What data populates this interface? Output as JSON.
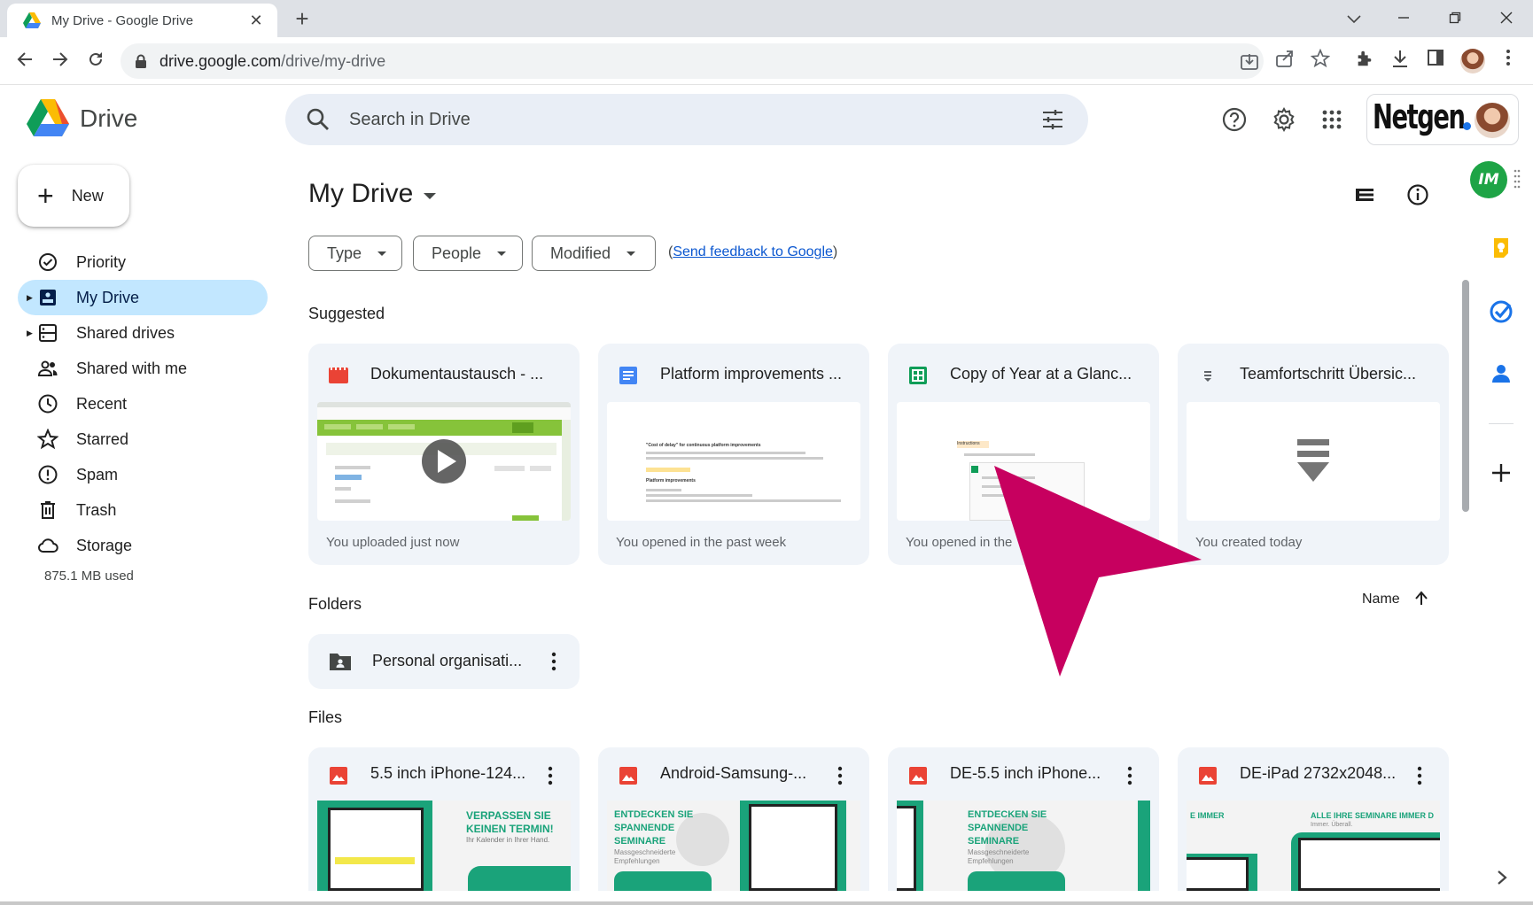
{
  "browser": {
    "tab_title": "My Drive - Google Drive",
    "url_host": "drive.google.com",
    "url_path": "/drive/my-drive"
  },
  "app": {
    "name": "Drive",
    "search_placeholder": "Search in Drive",
    "account_brand": "Netgen"
  },
  "sidebar": {
    "new_label": "New",
    "items": [
      {
        "label": "Priority",
        "icon": "priority-icon"
      },
      {
        "label": "My Drive",
        "icon": "my-drive-icon"
      },
      {
        "label": "Shared drives",
        "icon": "shared-drives-icon"
      },
      {
        "label": "Shared with me",
        "icon": "shared-with-me-icon"
      },
      {
        "label": "Recent",
        "icon": "clock-icon"
      },
      {
        "label": "Starred",
        "icon": "star-icon"
      },
      {
        "label": "Spam",
        "icon": "spam-icon"
      },
      {
        "label": "Trash",
        "icon": "trash-icon"
      },
      {
        "label": "Storage",
        "icon": "cloud-icon"
      }
    ],
    "storage_used": "875.1 MB used"
  },
  "main": {
    "title": "My Drive",
    "filters": {
      "type": "Type",
      "people": "People",
      "modified": "Modified",
      "feedback_prefix": "(",
      "feedback_link": "Send feedback to Google",
      "feedback_suffix": ")"
    },
    "suggested_label": "Suggested",
    "suggested": [
      {
        "name": "Dokumentaustausch - ...",
        "meta": "You uploaded just now",
        "icon": "video-file-icon"
      },
      {
        "name": "Platform improvements ...",
        "meta": "You opened in the past week",
        "icon": "google-docs-icon"
      },
      {
        "name": "Copy of Year at a Glanc...",
        "meta": "You opened in the",
        "icon": "google-sheets-icon"
      },
      {
        "name": "Teamfortschritt Übersic...",
        "meta": "You created today",
        "icon": "generic-file-icon"
      }
    ],
    "folders_label": "Folders",
    "sort_label": "Name",
    "folders": [
      {
        "name": "Personal organisati..."
      }
    ],
    "files_label": "Files",
    "files": [
      {
        "name": "5.5 inch iPhone-124..."
      },
      {
        "name": "Android-Samsung-..."
      },
      {
        "name": "DE-5.5 inch iPhone..."
      },
      {
        "name": "DE-iPad 2732x2048..."
      }
    ],
    "thumb_text": {
      "f1_a": "VERPASSEN SIE",
      "f1_b": "KEINEN TERMIN!",
      "f1_c": "Ihr Kalender in Ihrer Hand.",
      "f2_a": "ENTDECKEN SIE",
      "f2_b": "SPANNENDE",
      "f2_c": "SEMINARE",
      "f2_d": "Massgeschneiderte",
      "f2_e": "Empfehlungen",
      "f3_a": "ENTDECKEN SIE",
      "f3_b": "SPANNENDE",
      "f3_c": "SEMINARE",
      "f3_d": "Massgeschneiderte",
      "f3_e": "Empfehlungen",
      "f4_a": "E IMMER",
      "f4_b": "ALLE IHRE SEMINARE IMMER D",
      "f4_c": "Immer. Überall.",
      "doc_heading": "\"Cost of delay\" for continuous platform improvements",
      "doc_sub": "Platform improvements",
      "sheet_label": "Instructions"
    }
  },
  "colors": {
    "accent_blue": "#0b57d0",
    "active_nav": "#c2e7ff",
    "pointer": "#c7005f",
    "brand_green": "#1ea446"
  }
}
